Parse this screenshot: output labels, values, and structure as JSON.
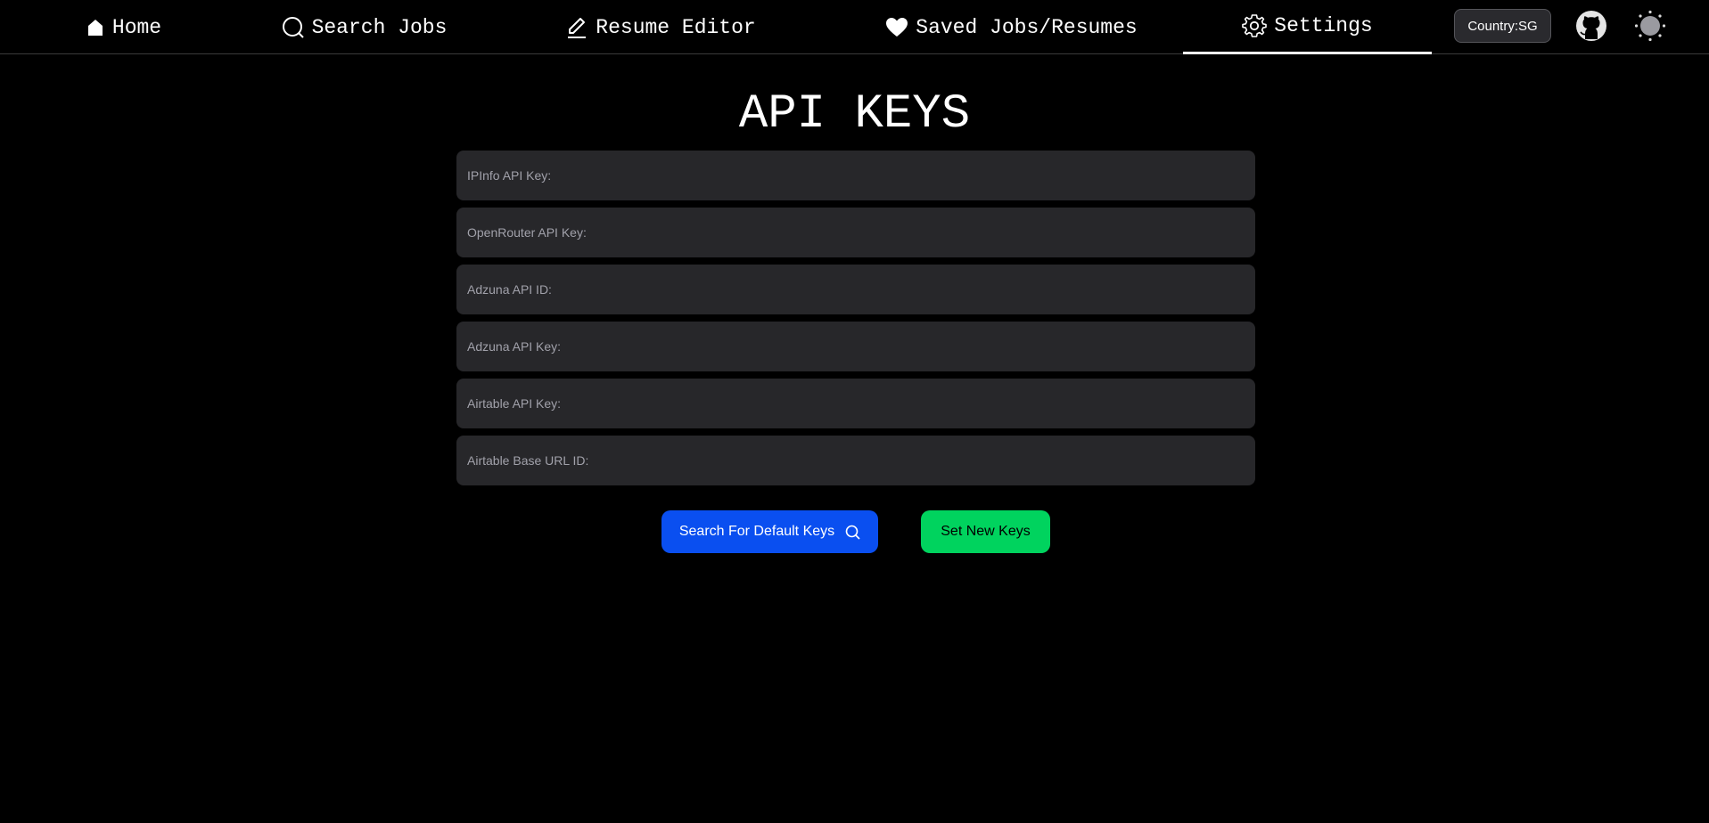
{
  "nav": {
    "tabs": [
      {
        "label": "Home",
        "icon": "home-icon"
      },
      {
        "label": "Search Jobs",
        "icon": "search-icon"
      },
      {
        "label": "Resume Editor",
        "icon": "pencil-icon"
      },
      {
        "label": "Saved Jobs/Resumes",
        "icon": "heart-icon"
      },
      {
        "label": "Settings",
        "icon": "gear-icon",
        "active": true
      }
    ],
    "country_label": "Country:SG",
    "github_icon": "github-icon",
    "theme_icon": "sun-icon"
  },
  "page": {
    "title": "API KEYS"
  },
  "fields": [
    {
      "placeholder": "IPInfo API Key:",
      "value": ""
    },
    {
      "placeholder": "OpenRouter API Key:",
      "value": ""
    },
    {
      "placeholder": "Adzuna API ID:",
      "value": ""
    },
    {
      "placeholder": "Adzuna API Key:",
      "value": ""
    },
    {
      "placeholder": "Airtable API Key:",
      "value": ""
    },
    {
      "placeholder": "Airtable Base URL ID:",
      "value": ""
    }
  ],
  "buttons": {
    "search_default_label": "Search For Default Keys",
    "set_new_label": "Set New Keys"
  },
  "colors": {
    "background": "#000000",
    "field_bg": "#27272a",
    "primary_blue": "#0a4ff0",
    "success_green": "#00d35e"
  }
}
